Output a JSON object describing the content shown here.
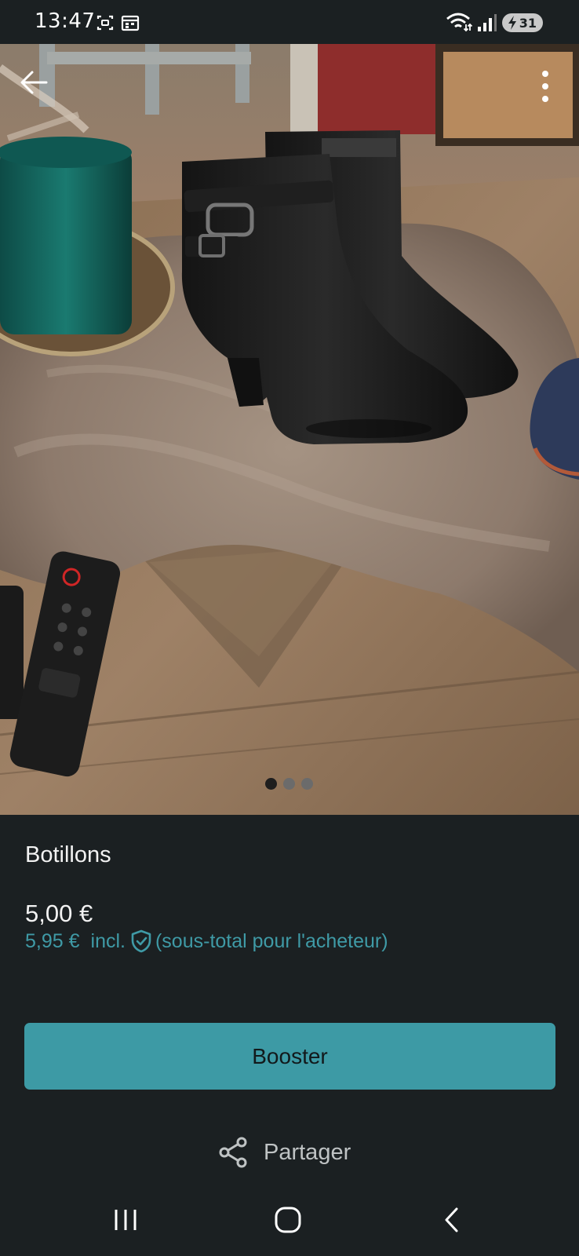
{
  "status_bar": {
    "time": "13:47",
    "battery_level": "31",
    "icons": [
      "screenshot-icon",
      "calendar-icon",
      "wifi-icon",
      "signal-icon",
      "battery-icon"
    ]
  },
  "photo": {
    "description_icons": [
      "back-arrow-icon",
      "more-vert-icon"
    ],
    "page_count": 3,
    "active_index": 0
  },
  "item": {
    "title": "Botillons",
    "price": "5,00 €",
    "buyer_price": "5,95 €",
    "incl_label": "incl.",
    "buyer_note": "(sous-total pour l'acheteur)"
  },
  "actions": {
    "boost_label": "Booster",
    "share_label": "Partager"
  },
  "colors": {
    "background": "#1b2022",
    "accent": "#3d9aa5",
    "accent_text": "#3f9aa6"
  }
}
